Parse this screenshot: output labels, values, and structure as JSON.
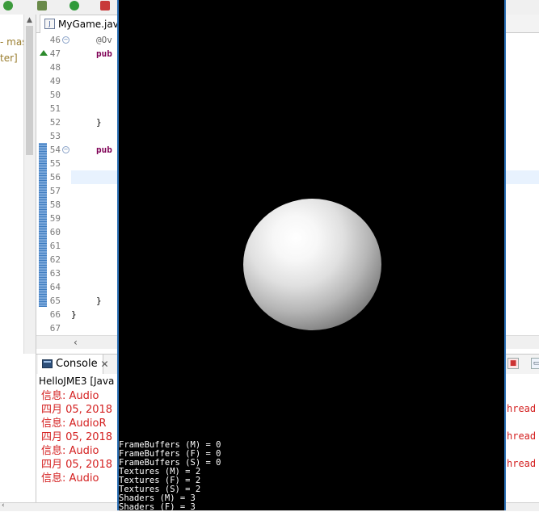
{
  "editor": {
    "tab_label": "MyGame.java",
    "line_numbers": [
      "46",
      "47",
      "48",
      "49",
      "50",
      "51",
      "52",
      "53",
      "54",
      "55",
      "56",
      "57",
      "58",
      "59",
      "60",
      "61",
      "62",
      "63",
      "64",
      "65",
      "66",
      "67"
    ],
    "code_lines": {
      "l46": "@Ov",
      "l47": "pub",
      "l52": "}",
      "l54": "pub",
      "l65": "}",
      "l66": "}"
    }
  },
  "left_panel": {
    "line1": "- mast",
    "line2": "ter]"
  },
  "console": {
    "tab_label": "Console",
    "close_glyph": "✕",
    "title": "HelloJME3 [Java",
    "lines": [
      "信息: Audio",
      "四月 05, 2018",
      "信息: AudioR",
      "四月 05, 2018",
      "信息: Audio",
      "四月 05, 2018",
      "信息: Audio"
    ],
    "right_fragments": [
      "hread",
      "hread",
      "hread"
    ]
  },
  "jme_window": {
    "stats": [
      "FrameBuffers (M) = 0",
      "FrameBuffers (F) = 0",
      "FrameBuffers (S) = 0",
      "Textures (M) = 2",
      "Textures (F) = 2",
      "Textures (S) = 2",
      "Shaders (M) = 3",
      "Shaders (F) = 3"
    ]
  },
  "colors": {
    "keyword": "#7f0055",
    "console_error": "#d42020",
    "jme_background": "#000000",
    "window_border": "#2b6fb5"
  }
}
